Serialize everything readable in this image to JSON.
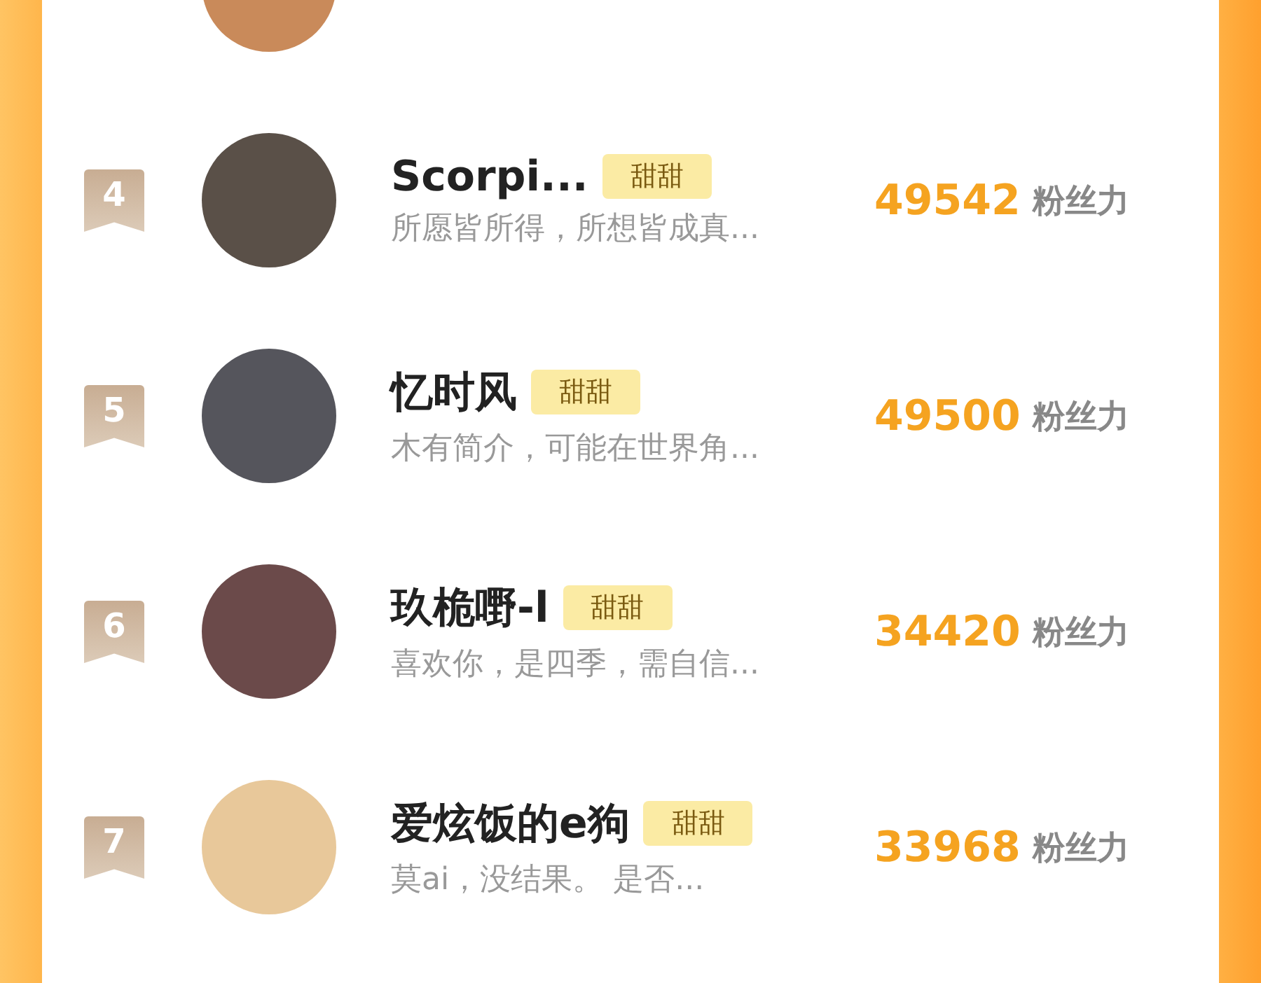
{
  "ranking": [
    {
      "rank": "4",
      "name": "Scorpi...",
      "tag": "甜甜",
      "bio": "所愿皆所得，所想皆成真...",
      "score": "49542",
      "score_unit": "粉丝力"
    },
    {
      "rank": "5",
      "name": "忆时风",
      "tag": "甜甜",
      "bio": "木有简介，可能在世界角...",
      "score": "49500",
      "score_unit": "粉丝力"
    },
    {
      "rank": "6",
      "name": "玖桅嘢-l",
      "tag": "甜甜",
      "bio": "喜欢你，是四季，需自信...",
      "score": "34420",
      "score_unit": "粉丝力"
    },
    {
      "rank": "7",
      "name": "爱炫饭的e狗",
      "tag": "甜甜",
      "bio": "莫ai，没结果。 是否...",
      "score": "33968",
      "score_unit": "粉丝力"
    }
  ]
}
